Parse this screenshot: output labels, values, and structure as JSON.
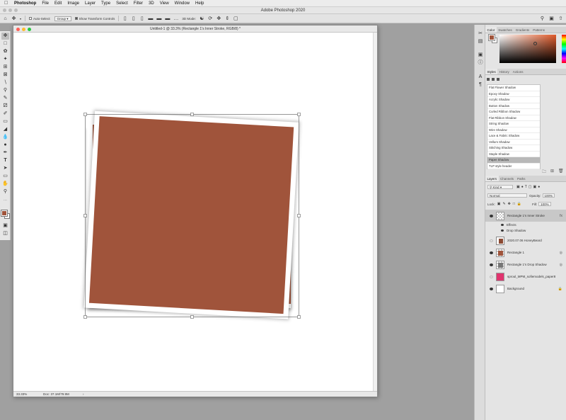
{
  "menubar": {
    "items": [
      "Photoshop",
      "File",
      "Edit",
      "Image",
      "Layer",
      "Type",
      "Select",
      "Filter",
      "3D",
      "View",
      "Window",
      "Help"
    ]
  },
  "app_title": "Adobe Photoshop 2020",
  "options_bar": {
    "auto_select_label": "Auto-Select:",
    "auto_select_value": "Group",
    "show_transform_label": "Show Transform Controls",
    "mode_3d_label": "3D Mode:"
  },
  "document": {
    "title": "Untitled-1 @ 33.3% (Rectangle 1's Inner Stroke, RGB/8) *",
    "zoom": "33.33%",
    "doc_size": "Doc: 37.1M/79.9M",
    "fill_color": "#a0543b"
  },
  "color_panel": {
    "tabs": [
      "Color",
      "Swatches",
      "Gradients",
      "Patterns"
    ],
    "foreground": "#a0543b",
    "background": "#ffffff"
  },
  "styles_panel": {
    "tabs": [
      "Styles",
      "History",
      "Actions"
    ],
    "items": [
      "Flat Flower Shadow",
      "Epoxy Shadow",
      "Acrylic Shadow",
      "Button Shadow",
      "Curled Ribbon Shadow",
      "Flat Ribbon Shadow",
      "String Shadow",
      "Wire Shadow",
      "Lace & Fabric Shadow",
      "Vellum Shadow",
      "Stitching Shadow",
      "Staple Shadow",
      "Paper Shadow",
      "TLP style header"
    ],
    "selected": "Paper Shadow"
  },
  "layers_panel": {
    "tabs": [
      "Layers",
      "Channels",
      "Paths"
    ],
    "filter_kind": "Kind",
    "blend_mode": "Normal",
    "opacity_label": "Opacity:",
    "opacity_value": "100%",
    "lock_label": "Lock:",
    "fill_label": "Fill:",
    "fill_value": "100%",
    "layers": [
      {
        "name": "Rectangle 1's Inner Stroke",
        "visible": true,
        "selected": true,
        "badge": "fx"
      },
      {
        "name": "Effects",
        "sub": true
      },
      {
        "name": "Drop Shadow",
        "sub": true
      },
      {
        "name": "2020.07.06 HoneyBeard",
        "visible": false
      },
      {
        "name": "Rectangle 1",
        "visible": true
      },
      {
        "name": "Rectangle 1's Drop Shadow",
        "visible": true
      },
      {
        "name": "sproul_MPM_sofiemodels_paper8",
        "visible": false
      },
      {
        "name": "Background",
        "visible": true,
        "badge": "lock"
      }
    ]
  }
}
